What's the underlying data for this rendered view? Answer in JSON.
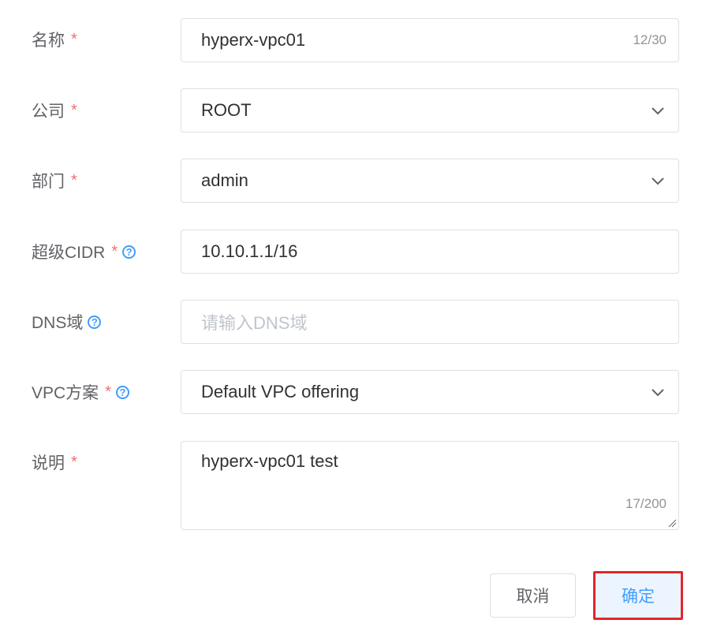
{
  "form": {
    "fields": [
      {
        "label": "名称",
        "required": "*",
        "value": "hyperx-vpc01",
        "counter": "12/30"
      },
      {
        "label": "公司",
        "required": "*",
        "value": "ROOT",
        "icon": "chevron-down-icon"
      },
      {
        "label": "部门",
        "required": "*",
        "value": "admin",
        "icon": "chevron-down-icon"
      },
      {
        "label": "超级CIDR",
        "required": "*",
        "help": "?",
        "value": "10.10.1.1/16"
      },
      {
        "label": "DNS域",
        "help": "?",
        "placeholder": "请输入DNS域"
      },
      {
        "label": "VPC方案",
        "required": "*",
        "help": "?",
        "value": "Default VPC offering",
        "icon": "chevron-down-icon"
      },
      {
        "label": "说明",
        "required": "*",
        "value": "hyperx-vpc01 test",
        "counter": "17/200"
      }
    ]
  },
  "buttons": {
    "cancel": "取消",
    "confirm": "确定"
  },
  "colors": {
    "required": "#f56c6c",
    "accent": "#409eff",
    "highlight_border": "#e3262c"
  }
}
